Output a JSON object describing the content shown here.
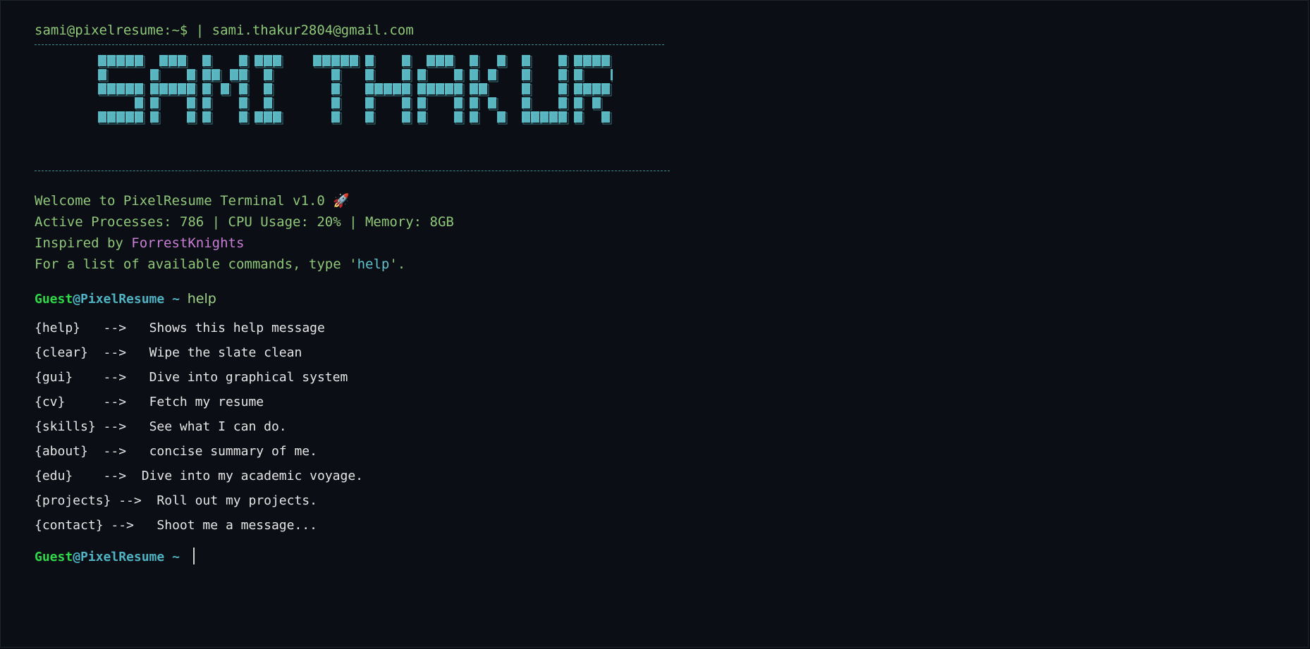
{
  "header": {
    "text": "sami@pixelresume:~$ | sami.thakur2804@gmail.com"
  },
  "banner": {
    "text": "SAMI THAKUR",
    "color": "#5fc3ce"
  },
  "welcome": {
    "line1": "Welcome to PixelResume Terminal v1.0 ",
    "rocket_icon": "🚀",
    "line2": "Active Processes: 786 | CPU Usage: 20% | Memory: 8GB",
    "line3_prefix": "Inspired by ",
    "line3_link": "ForrestKnights",
    "line4_prefix": "For a list of available commands, type ",
    "line4_quote_open": "'",
    "line4_cmd": "help",
    "line4_quote_close": "'",
    "line4_suffix": "."
  },
  "prompt": {
    "user": "Guest",
    "host": "@PixelResume",
    "tilde": " ~ ",
    "entered_command": "help"
  },
  "help_rows": [
    {
      "cmd": "{help}",
      "arrow": "   -->   ",
      "desc": "Shows this help message"
    },
    {
      "cmd": "{clear}",
      "arrow": "  -->   ",
      "desc": "Wipe the slate clean"
    },
    {
      "cmd": "{gui}",
      "arrow": "    -->   ",
      "desc": "Dive into graphical system"
    },
    {
      "cmd": "{cv}",
      "arrow": "     -->   ",
      "desc": "Fetch my resume"
    },
    {
      "cmd": "{skills}",
      "arrow": " -->   ",
      "desc": "See what I can do."
    },
    {
      "cmd": "{about}",
      "arrow": "  -->   ",
      "desc": "concise summary of me."
    },
    {
      "cmd": "{edu}",
      "arrow": "    -->  ",
      "desc": "Dive into my academic voyage."
    },
    {
      "cmd": "{projects}",
      "arrow": " -->  ",
      "desc": "Roll out my projects."
    },
    {
      "cmd": "{contact}",
      "arrow": " -->   ",
      "desc": "Shoot me a message..."
    }
  ],
  "colors": {
    "background": "#0b0e14",
    "text_green": "#8fc87a",
    "prompt_user": "#2fd94a",
    "prompt_host": "#4fb3c3",
    "link": "#c97fd6",
    "divider": "#3b8d8f"
  }
}
